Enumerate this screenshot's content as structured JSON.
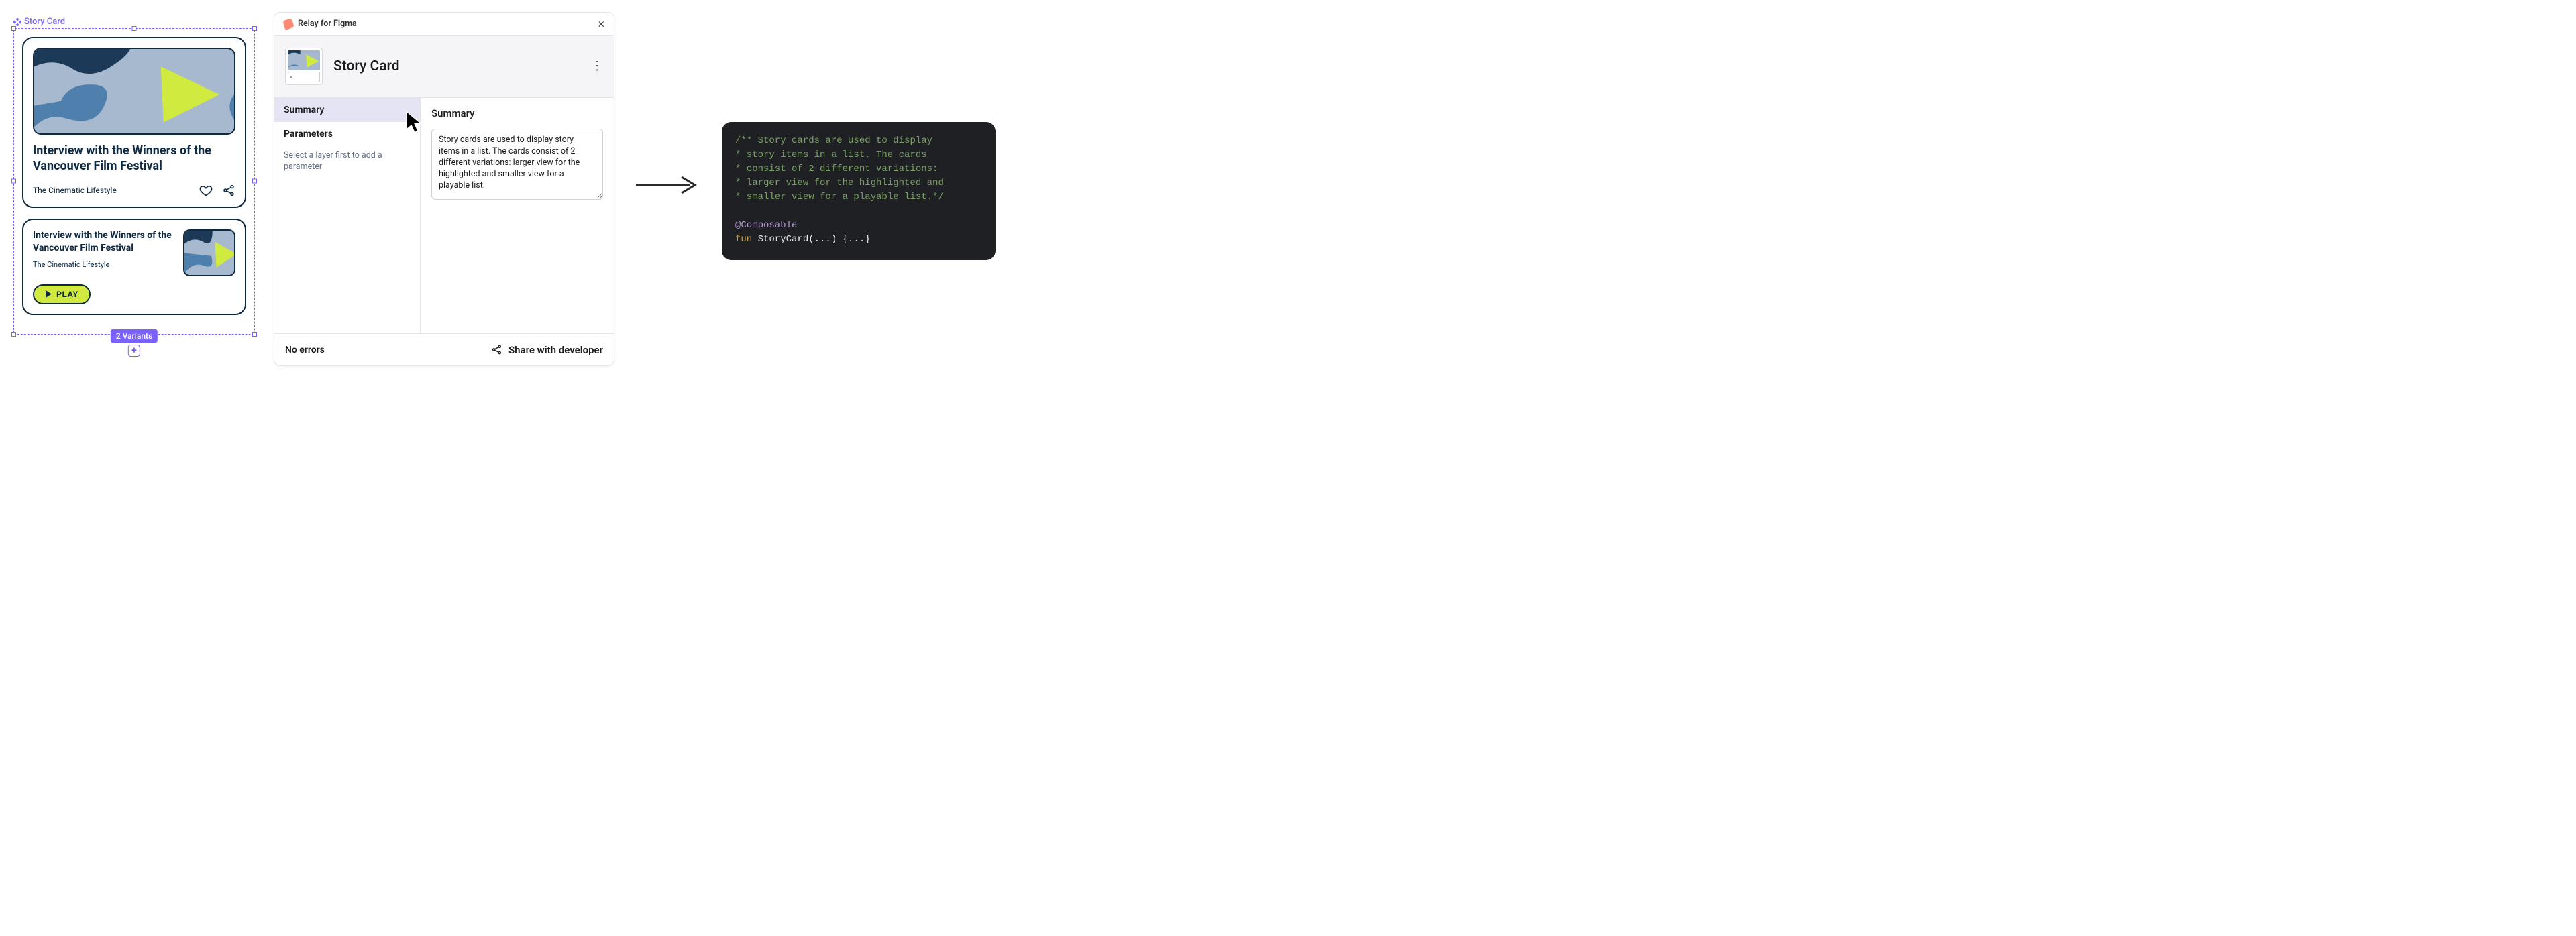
{
  "figma": {
    "component_label": "Story Card",
    "variant_badge": "2 Variants",
    "card_large": {
      "title": "Interview with the Winners of the Vancouver Film Festival",
      "publisher": "The Cinematic Lifestyle"
    },
    "card_small": {
      "title": "Interview with the Winners of the Vancouver Film Festival",
      "publisher": "The Cinematic Lifestyle",
      "play_label": "PLAY"
    }
  },
  "plugin": {
    "title": "Relay for Figma",
    "component_name": "Story Card",
    "tabs": {
      "summary": "Summary",
      "parameters": "Parameters",
      "parameters_note": "Select a layer first to add a parameter"
    },
    "summary_heading": "Summary",
    "summary_text": "Story cards are used to display story items in a list. The cards consist of 2 different variations: larger view for the highlighted and smaller view for a playable list.",
    "footer": {
      "status": "No errors",
      "share": "Share with developer"
    }
  },
  "code": {
    "doc_line1": "/** Story cards are used to display",
    "doc_line2": "* story items in a list. The cards",
    "doc_line3": "* consist of 2 different variations:",
    "doc_line4": "* larger view for the highlighted and",
    "doc_line5": "* smaller view for a playable list.*/",
    "annotation": "@Composable",
    "kw_fun": "fun",
    "fn_sig": " StoryCard(...) {...}"
  }
}
